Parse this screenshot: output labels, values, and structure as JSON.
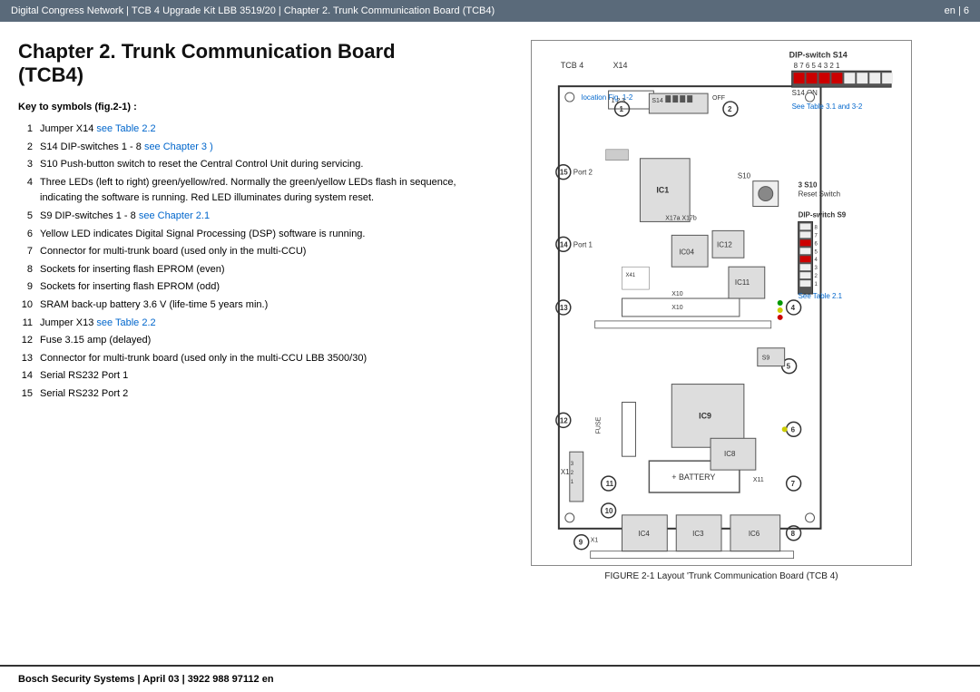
{
  "header": {
    "breadcrumb": "Digital Congress Network | TCB 4 Upgrade Kit LBB 3519/20 | Chapter 2. Trunk Communication Board (TCB4)",
    "page_info": "en | 6"
  },
  "chapter": {
    "title": "Chapter 2. Trunk Communication Board (TCB4)",
    "key_symbols_label": "Key to symbols (fig.2-1) :"
  },
  "items": [
    {
      "num": "1",
      "text": "Jumper X14 ",
      "link": "see Table 2.2",
      "rest": ""
    },
    {
      "num": "2",
      "text": "S14 DIP-switches 1 - 8  ",
      "link": "see Chapter 3 )",
      "rest": ""
    },
    {
      "num": "3",
      "text": "S10 Push-button switch to reset the Central Control Unit during servicing.",
      "link": "",
      "rest": ""
    },
    {
      "num": "4",
      "text": "Three LEDs (left to right) green/yellow/red.  Normally the green/yellow LEDs flash in sequence, indicating the software is running. Red LED illuminates during system reset.",
      "link": "",
      "rest": ""
    },
    {
      "num": "5",
      "text": "S9 DIP-switches 1 - 8 ",
      "link": "see Chapter 2.1",
      "rest": ""
    },
    {
      "num": "6",
      "text": "Yellow LED indicates Digital Signal Processing (DSP) software is running.",
      "link": "",
      "rest": ""
    },
    {
      "num": "7",
      "text": "Connector for multi-trunk board (used only in the multi-CCU)",
      "link": "",
      "rest": ""
    },
    {
      "num": "8",
      "text": "Sockets for inserting flash EPROM (even)",
      "link": "",
      "rest": ""
    },
    {
      "num": "9",
      "text": "Sockets for inserting flash EPROM (odd)",
      "link": "",
      "rest": ""
    },
    {
      "num": "10",
      "text": "SRAM back-up battery 3.6 V (life-time 5 years min.)",
      "link": "",
      "rest": ""
    },
    {
      "num": "11",
      "text": "Jumper X13 ",
      "link": "see Table 2.2",
      "rest": ""
    },
    {
      "num": "12",
      "text": "Fuse 3.15 amp (delayed)",
      "link": "",
      "rest": ""
    },
    {
      "num": "13",
      "text": "Connector for multi-trunk board (used only in the multi-CCU LBB 3500/30)",
      "link": "",
      "rest": ""
    },
    {
      "num": "14",
      "text": "Serial RS232 Port 1",
      "link": "",
      "rest": ""
    },
    {
      "num": "15",
      "text": "Serial RS232 Port 2",
      "link": "",
      "rest": ""
    }
  ],
  "diagram": {
    "figure_caption": "FIGURE 2-1  Layout 'Trunk Communication Board (TCB 4)",
    "tcb_label": "TCB 4",
    "x14_label": "X14",
    "dip_switch_s14_label": "DIP-switch S14",
    "s14_on_label": "S14   ON",
    "see_table_31_32": "See Table 3.1 and 3-2",
    "location_label": "location Fig. 1-2",
    "s10_label": "S10",
    "s10_desc": "Reset Switch",
    "dip_switch_s9_label": "DIP-switch S9",
    "see_table_21": "See Table 2.1",
    "battery_label": "BATTERY",
    "fuse_label": "FUSE",
    "x13_label": "X13",
    "x11_label": "X11",
    "x10_label": "X10",
    "port1_label": "Port 1",
    "port2_label": "Port 2",
    "ic_labels": [
      "IC1",
      "IC04",
      "IC11",
      "IC12",
      "IC8",
      "IC9",
      "IC4",
      "IC3",
      "IC6"
    ]
  },
  "footer": {
    "left": "Bosch Security Systems",
    "right": "April 03 | 3922 988 97112 en"
  }
}
